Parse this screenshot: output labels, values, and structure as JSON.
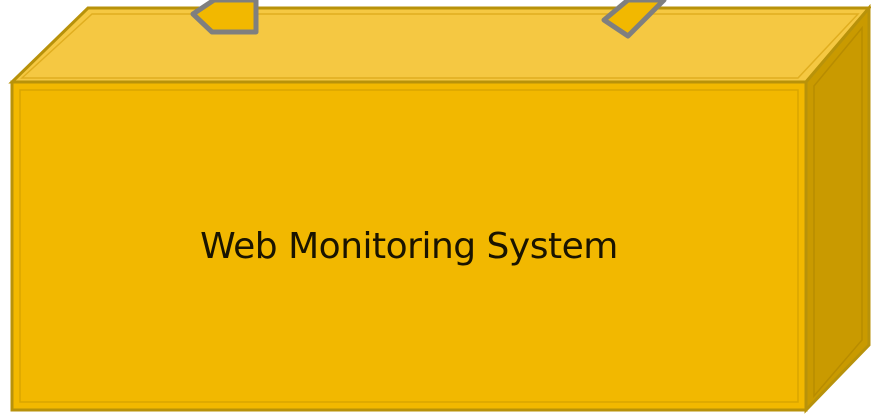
{
  "diagram": {
    "box": {
      "label": "Web Monitoring System",
      "front_color": "#F2B800",
      "top_color": "#F5C842",
      "side_color": "#C99A00",
      "border_color": "#B8920A"
    },
    "arrows": [
      {
        "name": "left-incoming-arrow",
        "direction": "down",
        "fill": "#F2B800",
        "stroke": "#7F7F7F"
      },
      {
        "name": "right-incoming-arrow",
        "direction": "down-left",
        "fill": "#F2B800",
        "stroke": "#7F7F7F"
      }
    ]
  }
}
